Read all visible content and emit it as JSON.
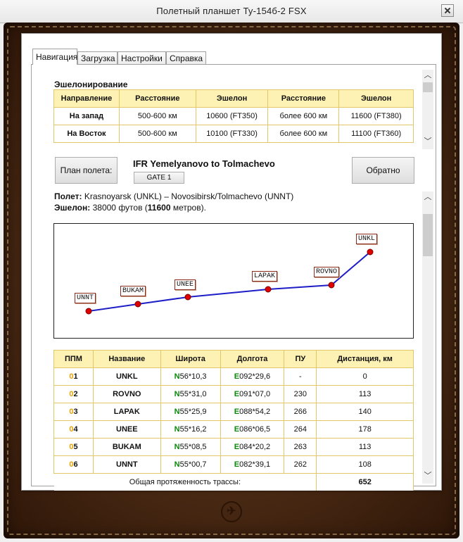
{
  "window": {
    "title": "Полетный планшет Ту-154б-2 FSX"
  },
  "tabs": [
    {
      "label": "Навигация"
    },
    {
      "label": "Загрузка"
    },
    {
      "label": "Настройки"
    },
    {
      "label": "Справка"
    }
  ],
  "echelon": {
    "title": "Эшелонирование",
    "headers": [
      "Направление",
      "Расстояние",
      "Эшелон",
      "Расстояние",
      "Эшелон"
    ],
    "rows": [
      [
        "На запад",
        "500-600 км",
        "10600 (FT350)",
        "более 600 км",
        "11600 (FT380)"
      ],
      [
        "На Восток",
        "500-600 км",
        "10100 (FT330)",
        "более 600 км",
        "11100 (FT360)"
      ]
    ]
  },
  "plan": {
    "plan_button": "План полета:",
    "route_title": "IFR Yemelyanovo to Tolmachevo",
    "gate": "GATE 1",
    "back_button": "Обратно"
  },
  "flight": {
    "flight_label": "Полет:",
    "flight_value": "Krasnoyarsk (UNKL)  –  Novosibirsk/Tolmachevo (UNNT)",
    "echelon_label": "Эшелон:",
    "echelon_feet": "38000 футов (",
    "echelon_meters": "11600",
    "echelon_suffix": " метров)."
  },
  "map": {
    "waypoints": [
      {
        "name": "UNNT"
      },
      {
        "name": "BUKAM"
      },
      {
        "name": "UNEE"
      },
      {
        "name": "LAPAK"
      },
      {
        "name": "ROVNO"
      },
      {
        "name": "UNKL"
      }
    ],
    "route_color": "#1e1ec8",
    "point_color": "#e00000"
  },
  "waypoints_table": {
    "headers": [
      "ППМ",
      "Название",
      "Широта",
      "Долгота",
      "ПУ",
      "Дистанция, км"
    ],
    "rows": [
      {
        "num_hi": "0",
        "num_lo": "1",
        "name": "UNKL",
        "lat_p": "N",
        "lat": "56*10,3",
        "lon_p": "E",
        "lon": "092*29,6",
        "pu": "-",
        "dist": "0"
      },
      {
        "num_hi": "0",
        "num_lo": "2",
        "name": "ROVNO",
        "lat_p": "N",
        "lat": "55*31,0",
        "lon_p": "E",
        "lon": "091*07,0",
        "pu": "230",
        "dist": "113"
      },
      {
        "num_hi": "0",
        "num_lo": "3",
        "name": "LAPAK",
        "lat_p": "N",
        "lat": "55*25,9",
        "lon_p": "E",
        "lon": "088*54,2",
        "pu": "266",
        "dist": "140"
      },
      {
        "num_hi": "0",
        "num_lo": "4",
        "name": "UNEE",
        "lat_p": "N",
        "lat": "55*16,2",
        "lon_p": "E",
        "lon": "086*06,5",
        "pu": "264",
        "dist": "178"
      },
      {
        "num_hi": "0",
        "num_lo": "5",
        "name": "BUKAM",
        "lat_p": "N",
        "lat": "55*08,5",
        "lon_p": "E",
        "lon": "084*20,2",
        "pu": "263",
        "dist": "113"
      },
      {
        "num_hi": "0",
        "num_lo": "6",
        "name": "UNNT",
        "lat_p": "N",
        "lat": "55*00,7",
        "lon_p": "E",
        "lon": "082*39,1",
        "pu": "262",
        "dist": "108"
      }
    ],
    "total_label": "Общая протяженность трассы:",
    "total_value": "652"
  },
  "icons": {
    "close": "close-icon",
    "scroll_up": "chevron-up-icon",
    "scroll_down": "chevron-down-icon",
    "emblem": "logo-emblem"
  }
}
